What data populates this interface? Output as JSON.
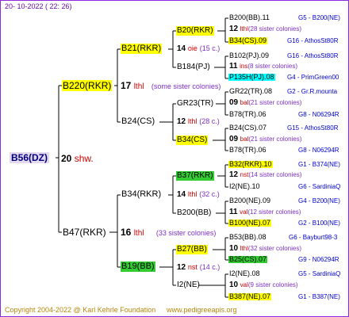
{
  "header": {
    "date": "20- 10-2022 ( 22: 26)"
  },
  "footer": {
    "copyright": "Copyright 2004-2022 @ Karl Kehrle Foundation",
    "site": "www.pedigreeapis.org"
  },
  "root": {
    "id": "B56(DZ)",
    "num": "20",
    "note": "shw."
  },
  "gen2": [
    {
      "id": "B220(RKR)",
      "num": "17",
      "suffix": "lthl",
      "note": "(some sister colonies)"
    },
    {
      "id": "B47(RKR)",
      "num": "16",
      "suffix": "lthl",
      "note": "(33 sister colonies)"
    }
  ],
  "gen3": [
    {
      "id": "B21(RKR)"
    },
    {
      "id": "B24(CS)"
    },
    {
      "id": "B34(RKR)"
    },
    {
      "id": "B19(BB)"
    }
  ],
  "gen4": [
    {
      "id": "B20(RKR)"
    },
    {
      "num": "14",
      "suffix": "oie",
      "note": "(15 c.)"
    },
    {
      "id": "B184(PJ)"
    },
    {
      "id": "GR23(TR)"
    },
    {
      "num": "12",
      "suffix": "lthl",
      "note": "(28 c.)"
    },
    {
      "id": "B34(CS)"
    },
    {
      "id": "B37(RKR)"
    },
    {
      "num": "14",
      "suffix": "lthl",
      "note": "(32 c.)"
    },
    {
      "id": "B200(BB)"
    },
    {
      "id": "B27(BB)"
    },
    {
      "num": "12",
      "suffix": "nst",
      "note": "(14 c.)"
    },
    {
      "id": "I2(NE)"
    }
  ],
  "gen5": [
    {
      "id": "B200(BB).11",
      "loc": "G5 - B200(NE)"
    },
    {
      "num": "12",
      "suffix": "lthl",
      "note": "(28 sister colonies)"
    },
    {
      "id": "B34(CS).09",
      "loc": "G16 - AthosSt80R"
    },
    {
      "id": "B102(PJ).09",
      "loc": "G16 - AthosSt80R"
    },
    {
      "num": "11",
      "suffix": "ins",
      "note": "(8 sister colonies)"
    },
    {
      "id": "P135H(PJ).08",
      "loc": "G4 - PrimGreen00"
    },
    {
      "id": "GR22(TR).08",
      "loc": "G2 - Gr.R.mounta"
    },
    {
      "num": "09",
      "suffix": "bal",
      "note": "(21 sister colonies)"
    },
    {
      "id": "B78(TR).06",
      "loc": "G8 - N06294R"
    },
    {
      "id": "B24(CS).07",
      "loc": "G15 - AthosSt80R"
    },
    {
      "num": "09",
      "suffix": "bal",
      "note": "(21 sister colonies)"
    },
    {
      "id": "B78(TR).06",
      "loc": "G8 - N06294R"
    },
    {
      "id": "B32(RKR).10",
      "loc": "G1 - B374(NE)"
    },
    {
      "num": "12",
      "suffix": "nst",
      "note": "(14 sister colonies)"
    },
    {
      "id": "I2(NE).10",
      "loc": "G6 - SardiniaQ"
    },
    {
      "id": "B200(NE).09",
      "loc": "G4 - B200(NE)"
    },
    {
      "num": "11",
      "suffix": "val",
      "note": "(12 sister colonies)"
    },
    {
      "id": "B100(NE).07",
      "loc": "G2 - B100(NE)"
    },
    {
      "id": "B53(BB).08",
      "loc": "G6 - Bayburt98-3"
    },
    {
      "num": "10",
      "suffix": "lthl",
      "note": "(32 sister colonies)"
    },
    {
      "id": "B25(CS).07",
      "loc": "G9 - N06294R"
    },
    {
      "id": "I2(NE).08",
      "loc": "G5 - SardiniaQ"
    },
    {
      "num": "10",
      "suffix": "val",
      "note": "(9 sister colonies)"
    },
    {
      "id": "B387(NE).07",
      "loc": "G1 - B387(NE)"
    }
  ]
}
